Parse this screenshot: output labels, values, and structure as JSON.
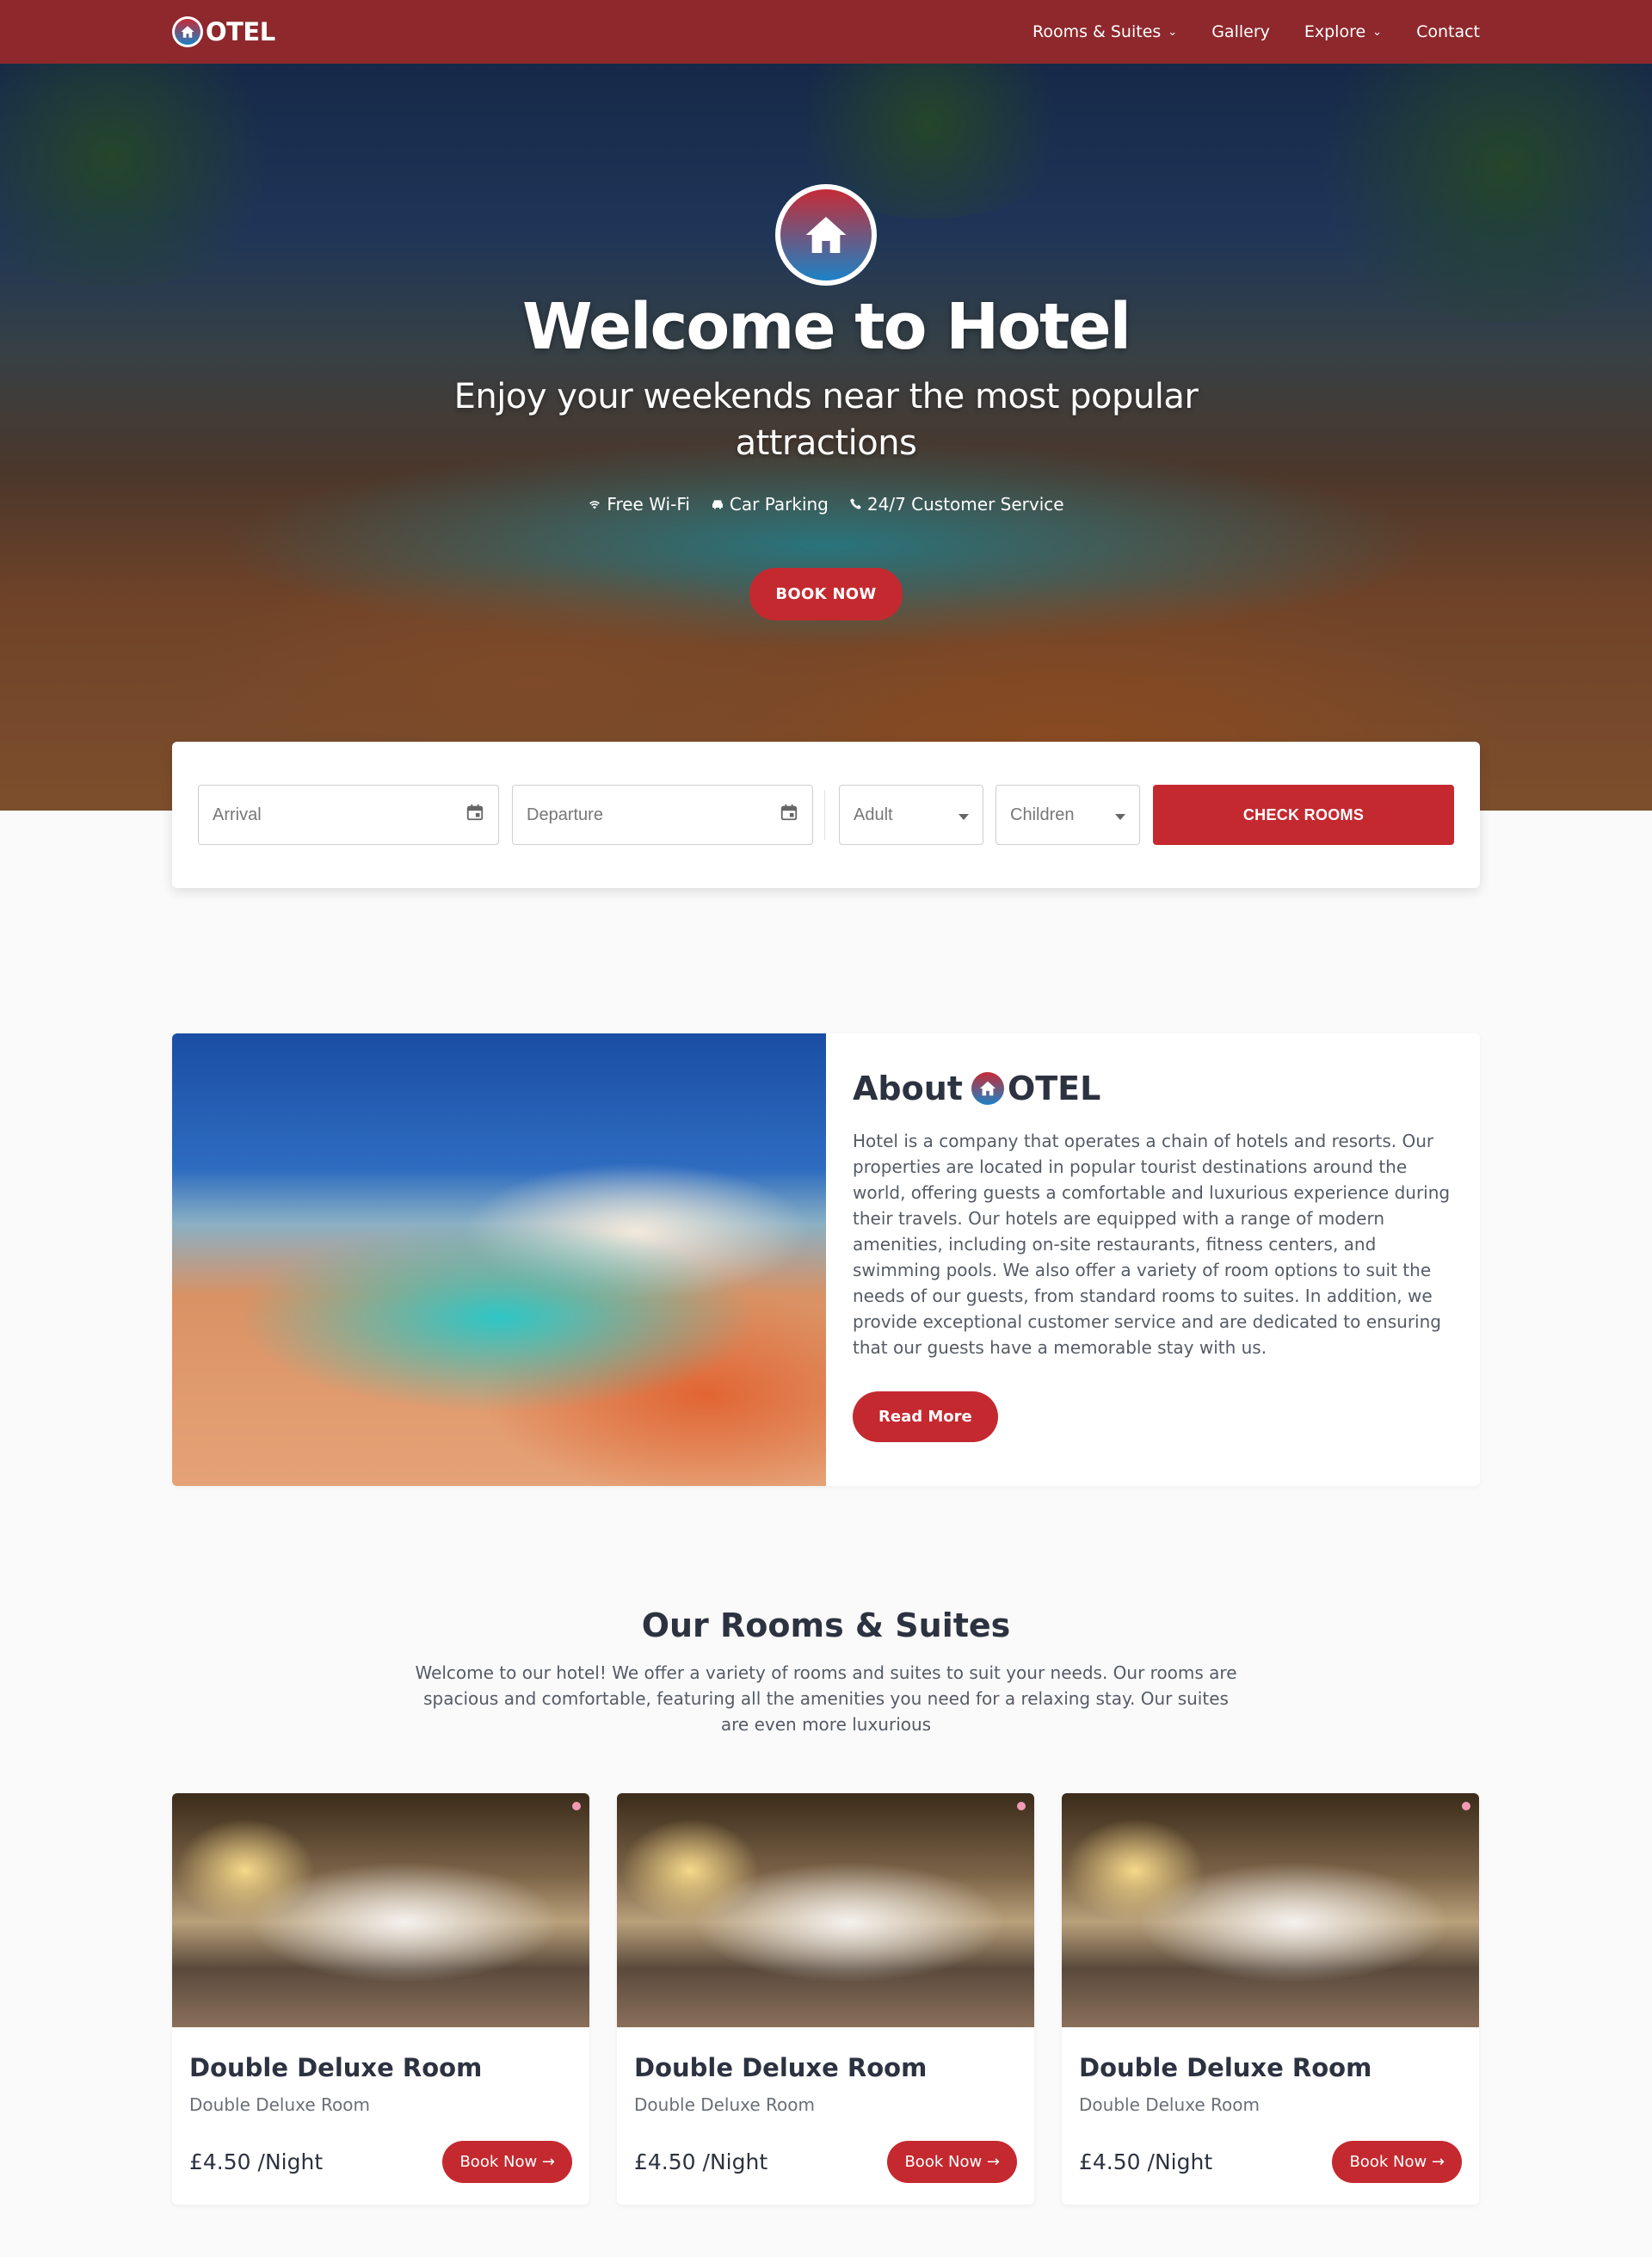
{
  "brand": {
    "text": "OTEL"
  },
  "nav": {
    "items": [
      {
        "label": "Rooms & Suites",
        "dropdown": true
      },
      {
        "label": "Gallery",
        "dropdown": false
      },
      {
        "label": "Explore",
        "dropdown": true
      },
      {
        "label": "Contact",
        "dropdown": false
      }
    ]
  },
  "hero": {
    "title": "Welcome to Hotel",
    "subtitle": "Enjoy your weekends near the most popular attractions",
    "features": [
      {
        "icon": "wifi-icon",
        "label": "Free Wi-Fi"
      },
      {
        "icon": "car-icon",
        "label": "Car Parking"
      },
      {
        "icon": "phone-icon",
        "label": "24/7 Customer Service"
      }
    ],
    "button": "BOOK NOW"
  },
  "booking": {
    "arrival_placeholder": "Arrival",
    "departure_placeholder": "Departure",
    "adult_placeholder": "Adult",
    "children_placeholder": "Children",
    "button": "CHECK ROOMS"
  },
  "about": {
    "title_prefix": "About",
    "title_brand": "OTEL",
    "body": "Hotel is a company that operates a chain of hotels and resorts. Our properties are located in popular tourist destinations around the world, offering guests a comfortable and luxurious experience during their travels. Our hotels are equipped with a range of modern amenities, including on-site restaurants, fitness centers, and swimming pools. We also offer a variety of room options to suit the needs of our guests, from standard rooms to suites. In addition, we provide exceptional customer service and are dedicated to ensuring that our guests have a memorable stay with us.",
    "button": "Read More"
  },
  "rooms": {
    "title": "Our Rooms & Suites",
    "intro": "Welcome to our hotel! We offer a variety of rooms and suites to suit your needs. Our rooms are spacious and comfortable, featuring all the amenities you need for a relaxing stay. Our suites are even more luxurious",
    "cards": [
      {
        "name": "Double Deluxe Room",
        "desc": "Double Deluxe Room",
        "price": "£4.50",
        "unit": "/Night",
        "button": "Book Now"
      },
      {
        "name": "Double Deluxe Room",
        "desc": "Double Deluxe Room",
        "price": "£4.50",
        "unit": "/Night",
        "button": "Book Now"
      },
      {
        "name": "Double Deluxe Room",
        "desc": "Double Deluxe Room",
        "price": "£4.50",
        "unit": "/Night",
        "button": "Book Now"
      }
    ]
  },
  "colors": {
    "primary": "#c4292f",
    "navbar": "#8e282c",
    "logo_top": "#c62b36",
    "logo_bottom": "#1c82c6"
  }
}
